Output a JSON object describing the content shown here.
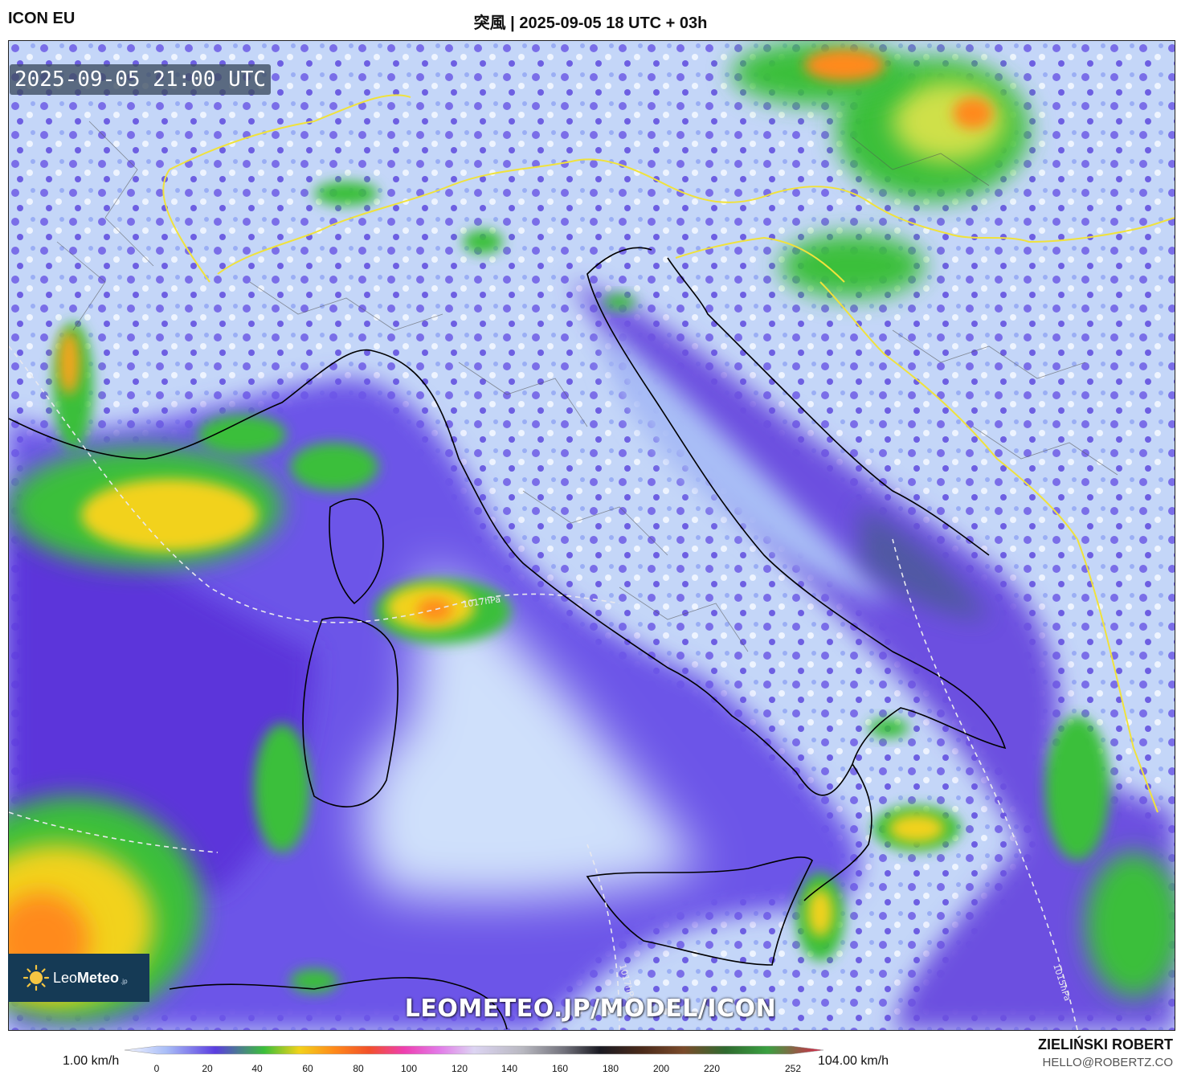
{
  "header": {
    "model": "ICON EU",
    "title": "突風 | 2025-09-05 18 UTC + 03h"
  },
  "map": {
    "valid_time": "2025-09-05 21:00 UTC",
    "watermark": "LEOMETEO.JP/MODEL/ICON",
    "isobar_labels": [
      "1017hPa",
      "1017hPa",
      "1015hPa"
    ],
    "colors": {
      "calm": "#cfe0fb",
      "light": "#8ea6f2",
      "moderate": "#5a3de0",
      "strong_green": "#3bbf3a",
      "strong_yellow": "#f2d21a",
      "very_strong": "#ff8a1a",
      "coastline": "#000000",
      "borders": "#f0e23c"
    }
  },
  "logo": {
    "name_light": "Leo",
    "name_bold": "Meteo",
    "suffix": ".jp"
  },
  "legend": {
    "min_label": "1.00 km/h",
    "max_label": "104.00 km/h",
    "ticks": [
      "0",
      "20",
      "40",
      "60",
      "80",
      "100",
      "120",
      "140",
      "160",
      "180",
      "200",
      "220",
      "252"
    ]
  },
  "credit": {
    "author": "ZIELIŃSKI ROBERT",
    "email": "HELLO@ROBERTZ.CO"
  }
}
